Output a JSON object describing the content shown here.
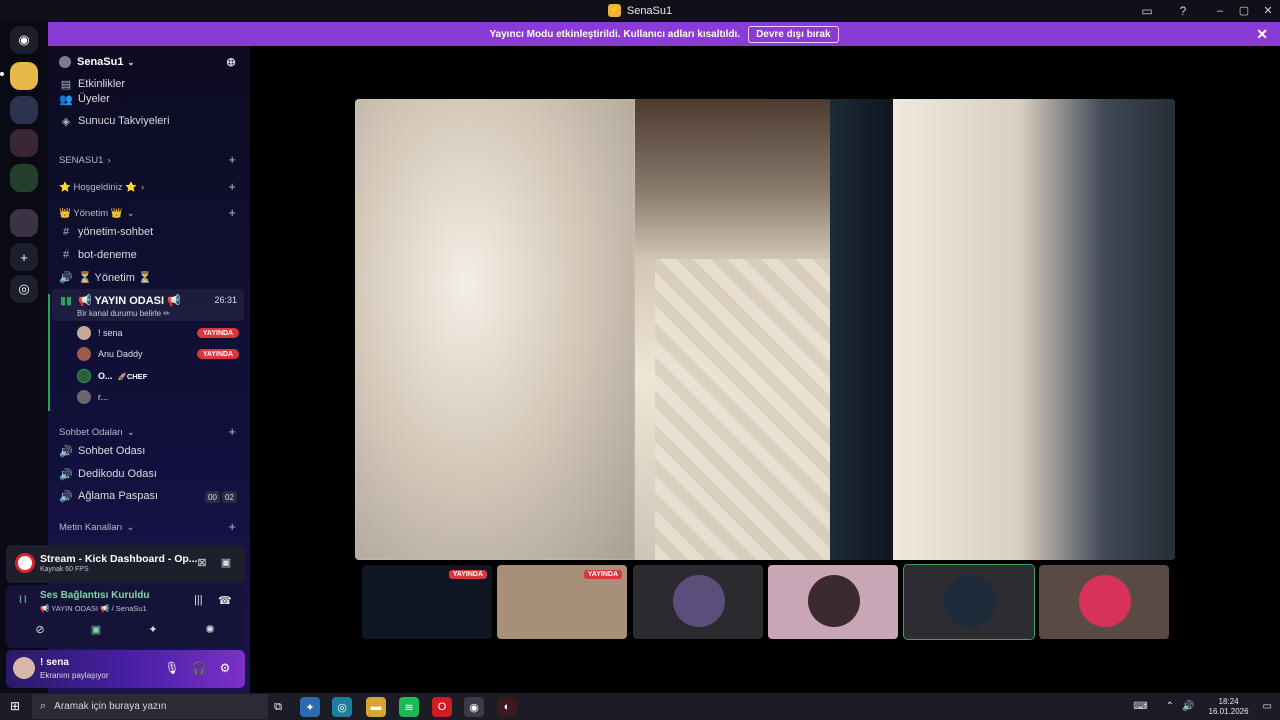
{
  "window": {
    "title": "SenaSu1"
  },
  "banner": {
    "text": "Yayıncı Modu etkinleştirildi. Kullanıcı adları kısaltıldı.",
    "button": "Devre dışı bırak"
  },
  "server": {
    "name": "SenaSu1"
  },
  "channels": {
    "partial_top": "Etkinlikler",
    "members": "Üyeler",
    "boosts": "Sunucu Takviyeleri",
    "cat_senasu1": "SENASU1",
    "welcome": "⭐ Hoşgeldiniz ⭐",
    "cat_yonetim": "👑 Yönetim 👑",
    "yonetim_sohbet": "yönetim-sohbet",
    "bot_deneme": "bot-deneme",
    "yonetim_voice": "⏳ Yönetim ⏳",
    "yayin_odasi": "📢 YAYIN ODASI 📢",
    "yayin_timer": "26:31",
    "yayin_status": "Bir kanal durumu belirle ✏",
    "cat_sohbet": "Sohbet Odaları",
    "sohbet_odasi": "Sohbet Odası",
    "dedikodu": "Dedikodu Odası",
    "aglama": "Ağlama Paspası",
    "aglama_count_a": "00",
    "aglama_count_b": "02",
    "cat_metin": "Metin Kanalları"
  },
  "voice_members": [
    {
      "name": "! sena",
      "badge": "YAYINDA"
    },
    {
      "name": "Anu Daddy",
      "badge": "YAYINDA"
    },
    {
      "name": "O...",
      "suffix": "🚀CHEF"
    },
    {
      "name": "r..."
    }
  ],
  "stream_card": {
    "title": "Stream - Kick Dashboard - Op...",
    "sub": "Kaynak 60 FPS"
  },
  "voice_panel": {
    "title": "Ses Bağlantısı Kuruldu",
    "sub": "📢 YAYIN ODASI 📢 / SenaSu1"
  },
  "user": {
    "name": "! sena",
    "status": "Ekranını paylaşıyor"
  },
  "thumbnails": [
    {
      "badge": "YAYINDA",
      "color": "#111827"
    },
    {
      "badge": "YAYINDA",
      "color": "#a88f7a"
    },
    {
      "color": "#2b2b2f"
    },
    {
      "color": "#c9a6b5"
    },
    {
      "color": "#2d2c33",
      "selected": true
    },
    {
      "color": "#5a4a44"
    }
  ],
  "taskbar": {
    "search_placeholder": "Aramak için buraya yazın",
    "time": "18:24",
    "date": "16.01.2026"
  },
  "colors": {
    "accent": "#8a3bd6",
    "live": "#da373c",
    "connected": "#84d3a5"
  }
}
